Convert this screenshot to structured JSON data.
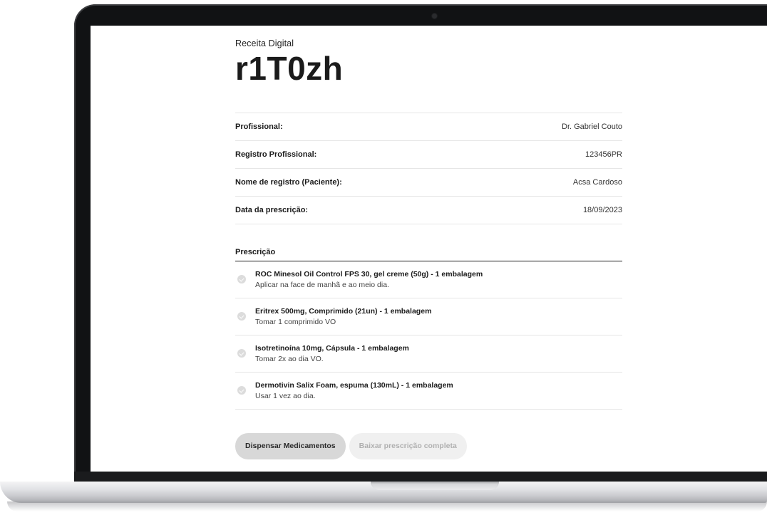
{
  "page": {
    "eyebrow": "Receita Digital",
    "code": "r1T0zh"
  },
  "info": [
    {
      "label": "Profissional:",
      "value": "Dr. Gabriel Couto"
    },
    {
      "label": "Registro Profissional:",
      "value": "123456PR"
    },
    {
      "label": "Nome de registro (Paciente):",
      "value": "Acsa Cardoso"
    },
    {
      "label": "Data da prescrição:",
      "value": "18/09/2023"
    }
  ],
  "prescription": {
    "title": "Prescrição",
    "items": [
      {
        "name": "ROC Minesol Oil Control FPS 30, gel creme (50g) - 1 embalagem",
        "dose": "Aplicar na face de manhã e ao meio dia."
      },
      {
        "name": "Eritrex 500mg, Comprimido (21un) - 1 embalagem",
        "dose": "Tomar 1 comprimido VO"
      },
      {
        "name": "Isotretinoína 10mg, Cápsula - 1 embalagem",
        "dose": "Tomar 2x ao dia VO."
      },
      {
        "name": "Dermotivin Salix Foam, espuma (130mL) - 1 embalagem",
        "dose": "Usar 1 vez ao dia."
      }
    ]
  },
  "actions": {
    "dispense_label": "Dispensar Medicamentos",
    "download_label": "Baixar prescrição completa"
  }
}
